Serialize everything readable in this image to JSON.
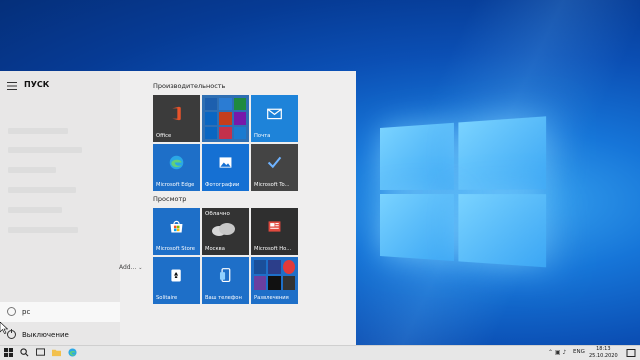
{
  "start_menu": {
    "title": "ПУСК",
    "user_label": "рс",
    "power_label": "Выключение",
    "overflow_label": "Add..."
  },
  "groups": [
    {
      "title": "Производительность"
    },
    {
      "title": "Просмотр"
    }
  ],
  "tiles": {
    "office": {
      "label": "Office",
      "color": "#3b3b3b"
    },
    "office_apps": {
      "label": "",
      "color": "#2f6fb3"
    },
    "mail": {
      "label": "Почта",
      "color": "#1e83d9"
    },
    "edge": {
      "label": "Microsoft Edge",
      "color": "#1e6fc8"
    },
    "photos": {
      "label": "Фотографии",
      "color": "#1570d3"
    },
    "todo": {
      "label": "Microsoft To...",
      "color": "#444444"
    },
    "store": {
      "label": "Microsoft Store",
      "color": "#1e6fc8"
    },
    "weather": {
      "label": "Москва",
      "heading": "Облачно",
      "color": "#333333"
    },
    "news": {
      "label": "Microsoft Ho...",
      "color": "#2f2f2f"
    },
    "solitaire": {
      "label": "Solitaire",
      "color": "#1e6fc8"
    },
    "phone": {
      "label": "Ваш телефон",
      "color": "#1e6fc8"
    },
    "entertainment": {
      "label": "Развлечения",
      "color": "#1e6fc8"
    }
  },
  "taskbar": {
    "tray_lang": "ENG",
    "time": "18:13",
    "date": "25.10.2020"
  }
}
